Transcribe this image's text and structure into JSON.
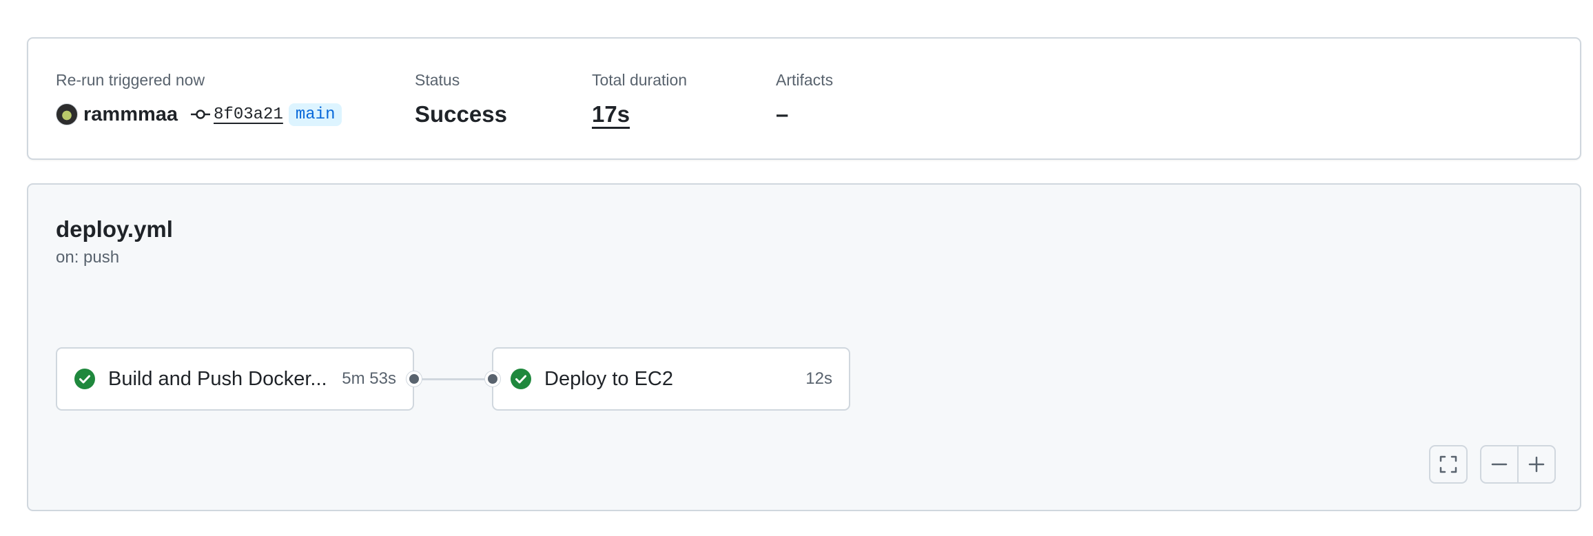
{
  "summary": {
    "trigger_label": "Re-run triggered now",
    "actor": "rammmaa",
    "commit_sha": "8f03a21",
    "branch": "main",
    "status_label": "Status",
    "status_value": "Success",
    "duration_label": "Total duration",
    "duration_value": "17s",
    "artifacts_label": "Artifacts",
    "artifacts_value": "–"
  },
  "workflow": {
    "file_name": "deploy.yml",
    "trigger": "on: push",
    "jobs": [
      {
        "name": "Build and Push Docker...",
        "duration": "5m 53s",
        "status": "success",
        "icon": "check-circle-icon"
      },
      {
        "name": "Deploy to EC2",
        "duration": "12s",
        "status": "success",
        "icon": "check-circle-icon"
      }
    ]
  },
  "controls": {
    "fullscreen_icon": "fullscreen-icon",
    "zoom_out_icon": "minus-icon",
    "zoom_in_icon": "plus-icon"
  },
  "colors": {
    "success": "#1f883d",
    "link": "#0969da",
    "border": "#d0d7de",
    "muted_text": "#59636e"
  }
}
